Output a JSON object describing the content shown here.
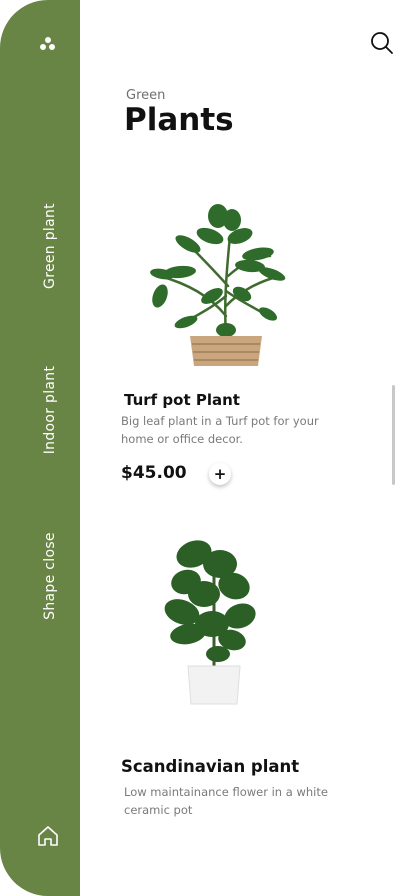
{
  "sidebar": {
    "tabs": [
      {
        "label": "Green plant"
      },
      {
        "label": "Indoor plant"
      },
      {
        "label": "Shape close"
      }
    ]
  },
  "header": {
    "subtitle": "Green",
    "title": "Plants"
  },
  "products": [
    {
      "name": "Turf pot Plant",
      "description": "Big leaf plant in a Turf pot for your home or office decor.",
      "price": "$45.00",
      "add_label": "+"
    },
    {
      "name": "Scandinavian plant",
      "description": "Low maintainance flower in a white ceramic pot"
    }
  ],
  "colors": {
    "sidebar_green": "#698545",
    "text_dark": "#111111",
    "text_muted": "#7a7a7a"
  },
  "icons": [
    "menu-dots-icon",
    "search-icon",
    "home-icon",
    "plus-icon"
  ]
}
